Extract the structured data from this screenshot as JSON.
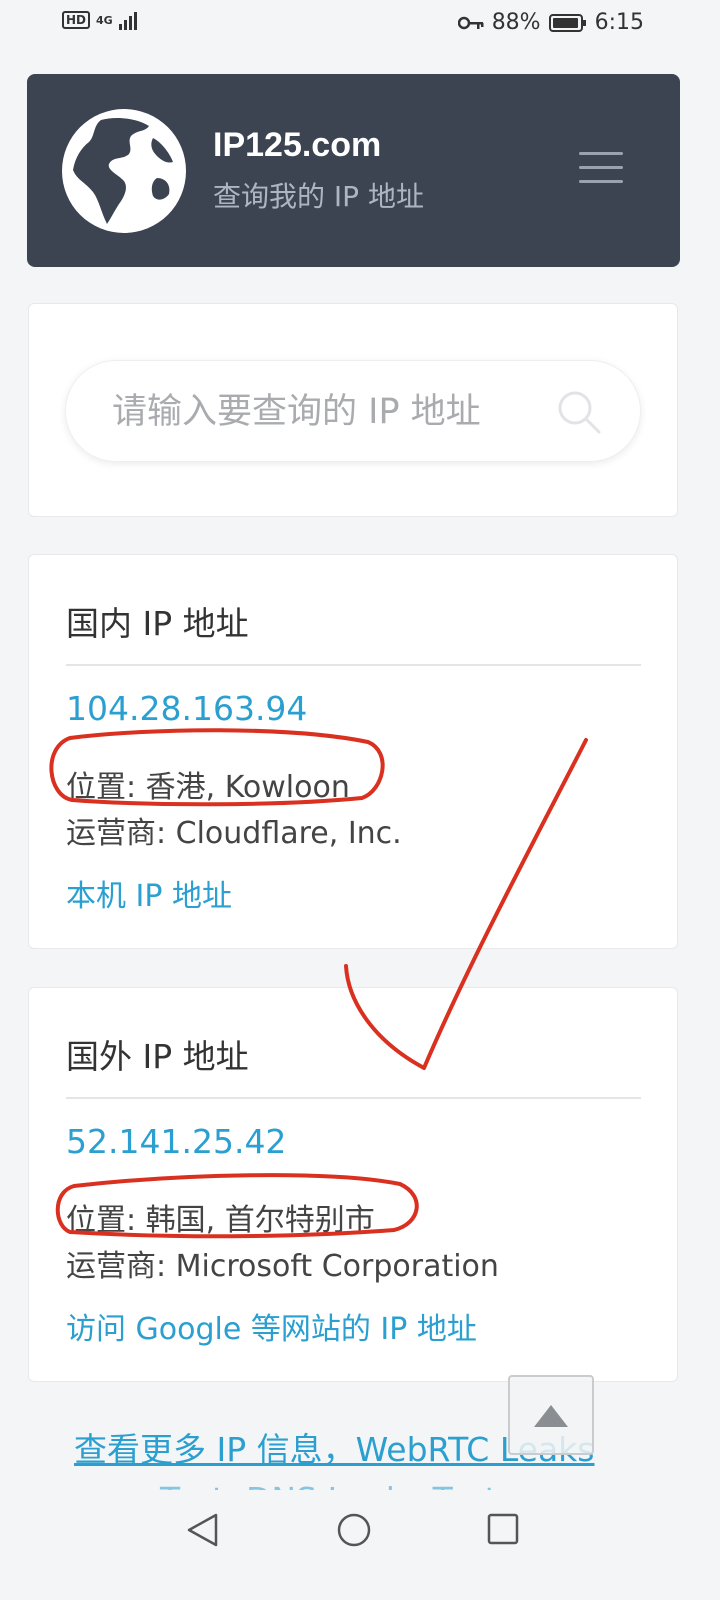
{
  "status_bar": {
    "hd": "HD",
    "network": "4G",
    "battery_percent": "88%",
    "time": "6:15"
  },
  "header": {
    "title": "IP125.com",
    "subtitle": "查询我的 IP 地址"
  },
  "search": {
    "placeholder": "请输入要查询的 IP 地址"
  },
  "domestic": {
    "title": "国内 IP 地址",
    "ip": "104.28.163.94",
    "location": "位置: 香港, Kowloon",
    "isp": "运营商: Cloudflare, Inc.",
    "link": "本机 IP 地址"
  },
  "foreign": {
    "title": "国外 IP 地址",
    "ip": "52.141.25.42",
    "location": "位置: 韩国, 首尔特别市",
    "isp": "运营商: Microsoft Corporation",
    "link": "访问 Google 等网站的 IP 地址"
  },
  "footer": {
    "more_link": "查看更多 IP 信息，WebRTC Leaks",
    "more_link_2": "Test, DNS Leaks Test"
  },
  "colors": {
    "header_bg": "#3c4452",
    "link": "#2a9fd0",
    "annotation": "#d9301f"
  }
}
